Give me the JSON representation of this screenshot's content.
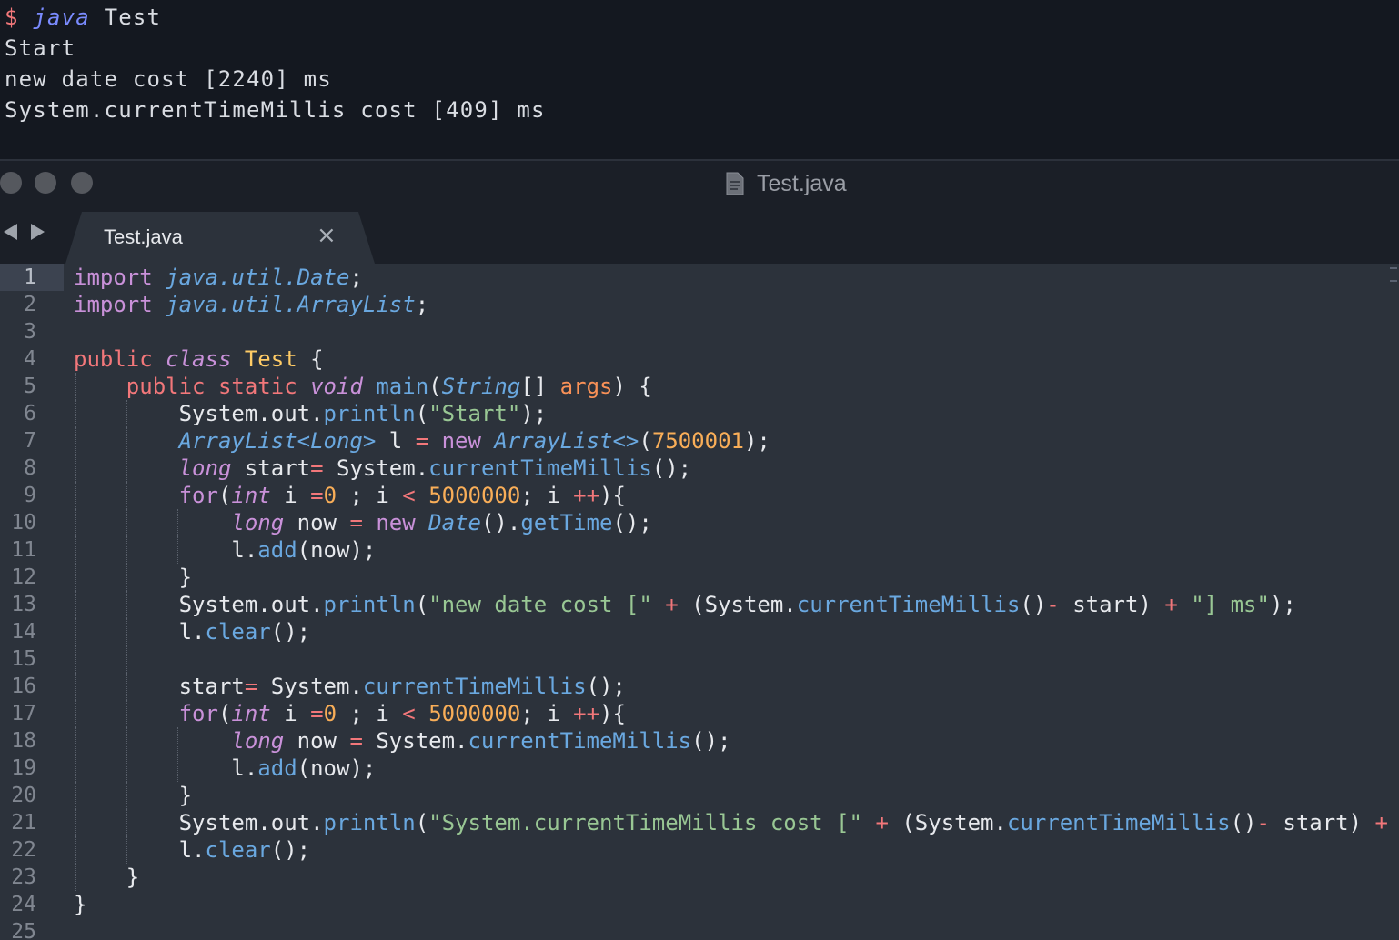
{
  "terminal": {
    "prompt": "$",
    "command": "java",
    "argument": "Test",
    "output": [
      "Start",
      "new date cost [2240] ms",
      "System.currentTimeMillis cost [409] ms"
    ]
  },
  "window": {
    "title": "Test.java"
  },
  "tab": {
    "label": "Test.java",
    "close_glyph": "×"
  },
  "editor": {
    "line_numbers": [
      "1",
      "2",
      "3",
      "4",
      "5",
      "6",
      "7",
      "8",
      "9",
      "10",
      "11",
      "12",
      "13",
      "14",
      "15",
      "16",
      "17",
      "18",
      "19",
      "20",
      "21",
      "22",
      "23",
      "24",
      "25"
    ],
    "active_line": 1
  },
  "colors": {
    "background": "#2c323b",
    "terminal_bg": "#141820",
    "keyword": "#f2777a",
    "storage": "#c991d9",
    "type": "#6aa8e0",
    "string": "#99c794",
    "number": "#f9ae58"
  }
}
